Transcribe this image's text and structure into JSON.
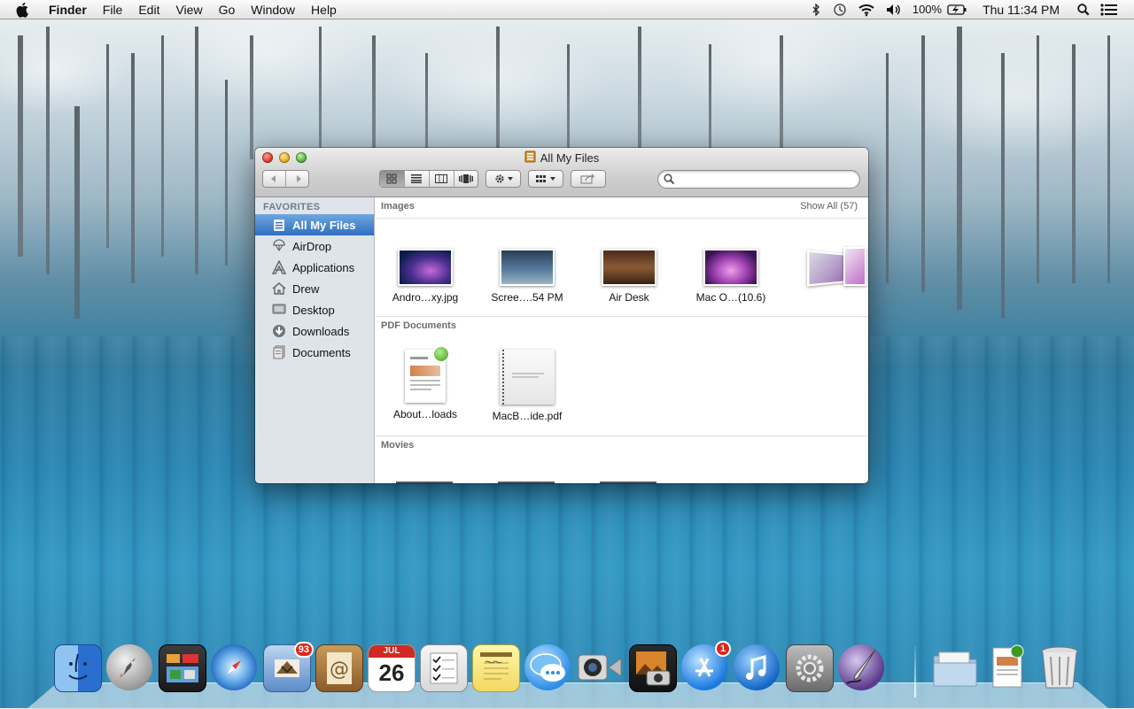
{
  "menubar": {
    "app_name": "Finder",
    "menus": [
      "File",
      "Edit",
      "View",
      "Go",
      "Window",
      "Help"
    ],
    "battery": "100%",
    "clock": "Thu 11:34 PM"
  },
  "window": {
    "title": "All My Files",
    "sidebar": {
      "heading": "FAVORITES",
      "items": [
        {
          "label": "All My Files",
          "icon": "all-my-files-icon",
          "selected": true
        },
        {
          "label": "AirDrop",
          "icon": "airdrop-icon",
          "selected": false
        },
        {
          "label": "Applications",
          "icon": "applications-icon",
          "selected": false
        },
        {
          "label": "Drew",
          "icon": "home-icon",
          "selected": false
        },
        {
          "label": "Desktop",
          "icon": "desktop-icon",
          "selected": false
        },
        {
          "label": "Downloads",
          "icon": "downloads-icon",
          "selected": false
        },
        {
          "label": "Documents",
          "icon": "documents-icon",
          "selected": false
        }
      ]
    },
    "sections": {
      "images": {
        "title": "Images",
        "show_all": "Show All (57)",
        "items": [
          "Andro…xy.jpg",
          "Scree….54 PM",
          "Air Desk",
          "Mac O…(10.6)"
        ]
      },
      "pdf": {
        "title": "PDF Documents",
        "items": [
          "About…loads",
          "MacB…ide.pdf"
        ]
      },
      "movies": {
        "title": "Movies"
      }
    }
  },
  "dock": {
    "apps": [
      {
        "name": "Finder",
        "icon": "finder-icon"
      },
      {
        "name": "Launchpad",
        "icon": "launchpad-icon"
      },
      {
        "name": "Mission Control",
        "icon": "mission-control-icon"
      },
      {
        "name": "Safari",
        "icon": "safari-icon"
      },
      {
        "name": "Mail",
        "icon": "mail-icon",
        "badge": "93"
      },
      {
        "name": "Contacts",
        "icon": "contacts-icon"
      },
      {
        "name": "Calendar",
        "icon": "calendar-icon",
        "month": "JUL",
        "day": "26"
      },
      {
        "name": "Reminders",
        "icon": "reminders-icon"
      },
      {
        "name": "Notes",
        "icon": "notes-icon"
      },
      {
        "name": "Messages",
        "icon": "messages-icon"
      },
      {
        "name": "FaceTime",
        "icon": "facetime-icon"
      },
      {
        "name": "Photo Booth",
        "icon": "photo-booth-icon"
      },
      {
        "name": "App Store",
        "icon": "app-store-icon",
        "badge": "1"
      },
      {
        "name": "iTunes",
        "icon": "itunes-icon"
      },
      {
        "name": "System Preferences",
        "icon": "system-preferences-icon"
      },
      {
        "name": "Script Editor",
        "icon": "script-editor-icon"
      },
      {
        "name": "Applications Stack",
        "icon": "folder-stack-icon"
      },
      {
        "name": "Downloads Stack",
        "icon": "downloads-stack-icon"
      },
      {
        "name": "Trash",
        "icon": "trash-icon"
      }
    ]
  }
}
